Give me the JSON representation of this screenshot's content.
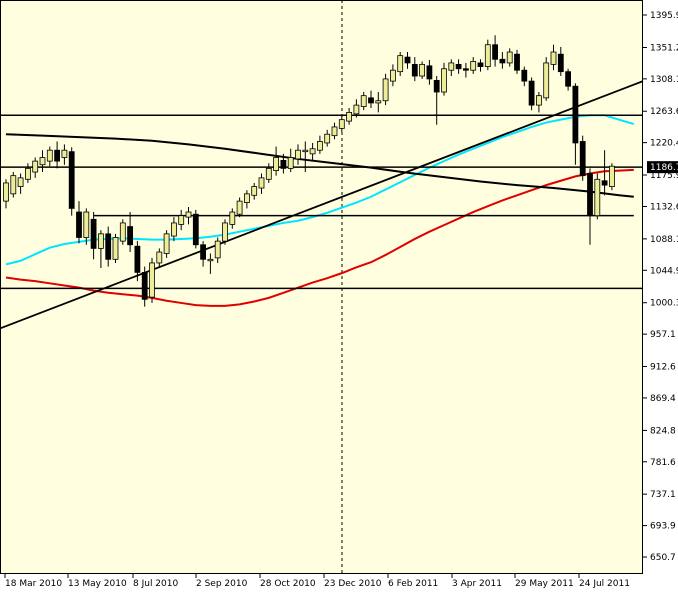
{
  "chart_data": {
    "type": "candlestick",
    "background": "#FFFFE0",
    "candle_up_fill": "#EEEE99",
    "candle_down_fill": "#000000",
    "ylim": [
      650.7,
      1395.9
    ],
    "y_ticks": [
      "1395.9",
      "1351.2",
      "1308.1",
      "1263.6",
      "1220.4",
      "1175.9",
      "1132.6",
      "1088.1",
      "1044.9",
      "1000.3",
      "957.1",
      "912.6",
      "869.4",
      "824.8",
      "781.6",
      "737.1",
      "693.9",
      "650.7"
    ],
    "x_labels": [
      "18 Mar 2010",
      "13 May 2010",
      "8 Jul 2010",
      "2 Sep 2010",
      "28 Oct 2010",
      "23 Dec 2010",
      "6 Feb 2011",
      "3 Apr 2011",
      "29 May 2011",
      "24 Jul 2011"
    ],
    "current_price_label": "1186.7",
    "current_price": 1186.7,
    "period_separator": "23 Dec 2010",
    "candles": [
      [
        1140,
        1165,
        1130,
        1170
      ],
      [
        1150,
        1175,
        1145,
        1180
      ],
      [
        1160,
        1172,
        1150,
        1178
      ],
      [
        1170,
        1185,
        1165,
        1192
      ],
      [
        1180,
        1195,
        1172,
        1200
      ],
      [
        1190,
        1200,
        1180,
        1210
      ],
      [
        1195,
        1210,
        1188,
        1215
      ],
      [
        1210,
        1195,
        1185,
        1222
      ],
      [
        1200,
        1210,
        1190,
        1218
      ],
      [
        1208,
        1130,
        1120,
        1214
      ],
      [
        1125,
        1090,
        1082,
        1140
      ],
      [
        1090,
        1125,
        1080,
        1130
      ],
      [
        1115,
        1075,
        1060,
        1125
      ],
      [
        1075,
        1095,
        1048,
        1100
      ],
      [
        1095,
        1060,
        1050,
        1105
      ],
      [
        1060,
        1090,
        1055,
        1095
      ],
      [
        1085,
        1110,
        1080,
        1115
      ],
      [
        1105,
        1080,
        1070,
        1125
      ],
      [
        1078,
        1042,
        1030,
        1085
      ],
      [
        1042,
        1005,
        995,
        1050
      ],
      [
        1008,
        1055,
        1000,
        1062
      ],
      [
        1055,
        1070,
        1048,
        1075
      ],
      [
        1068,
        1095,
        1062,
        1100
      ],
      [
        1092,
        1110,
        1085,
        1118
      ],
      [
        1108,
        1120,
        1100,
        1128
      ],
      [
        1118,
        1125,
        1108,
        1132
      ],
      [
        1122,
        1080,
        1075,
        1128
      ],
      [
        1080,
        1060,
        1050,
        1085
      ],
      [
        1058,
        1060,
        1040,
        1068
      ],
      [
        1062,
        1085,
        1055,
        1090
      ],
      [
        1085,
        1110,
        1080,
        1115
      ],
      [
        1108,
        1125,
        1102,
        1130
      ],
      [
        1122,
        1140,
        1118,
        1145
      ],
      [
        1138,
        1150,
        1130,
        1155
      ],
      [
        1148,
        1160,
        1142,
        1165
      ],
      [
        1158,
        1172,
        1150,
        1178
      ],
      [
        1170,
        1185,
        1165,
        1192
      ],
      [
        1182,
        1200,
        1175,
        1215
      ],
      [
        1196,
        1185,
        1178,
        1205
      ],
      [
        1185,
        1200,
        1180,
        1212
      ],
      [
        1198,
        1210,
        1190,
        1218
      ],
      [
        1208,
        1210,
        1180,
        1222
      ],
      [
        1205,
        1212,
        1195,
        1220
      ],
      [
        1210,
        1222,
        1205,
        1230
      ],
      [
        1220,
        1232,
        1215,
        1238
      ],
      [
        1230,
        1242,
        1225,
        1248
      ],
      [
        1240,
        1252,
        1235,
        1258
      ],
      [
        1250,
        1262,
        1245,
        1268
      ],
      [
        1260,
        1272,
        1255,
        1280
      ],
      [
        1270,
        1285,
        1265,
        1290
      ],
      [
        1282,
        1275,
        1268,
        1292
      ],
      [
        1275,
        1278,
        1262,
        1290
      ],
      [
        1278,
        1308,
        1272,
        1315
      ],
      [
        1305,
        1320,
        1298,
        1328
      ],
      [
        1318,
        1340,
        1312,
        1345
      ],
      [
        1338,
        1330,
        1322,
        1345
      ],
      [
        1328,
        1312,
        1305,
        1338
      ],
      [
        1312,
        1328,
        1308,
        1332
      ],
      [
        1326,
        1308,
        1300,
        1334
      ],
      [
        1306,
        1290,
        1245,
        1312
      ],
      [
        1290,
        1322,
        1285,
        1330
      ],
      [
        1320,
        1330,
        1312,
        1335
      ],
      [
        1328,
        1322,
        1315,
        1335
      ],
      [
        1322,
        1320,
        1310,
        1330
      ],
      [
        1320,
        1332,
        1315,
        1338
      ],
      [
        1330,
        1325,
        1318,
        1335
      ],
      [
        1325,
        1355,
        1320,
        1362
      ],
      [
        1355,
        1335,
        1325,
        1368
      ],
      [
        1335,
        1330,
        1322,
        1345
      ],
      [
        1330,
        1345,
        1325,
        1350
      ],
      [
        1342,
        1320,
        1315,
        1348
      ],
      [
        1320,
        1305,
        1298,
        1325
      ],
      [
        1305,
        1272,
        1265,
        1310
      ],
      [
        1272,
        1285,
        1262,
        1290
      ],
      [
        1282,
        1330,
        1278,
        1338
      ],
      [
        1328,
        1345,
        1320,
        1355
      ],
      [
        1342,
        1318,
        1312,
        1352
      ],
      [
        1318,
        1298,
        1292,
        1322
      ],
      [
        1298,
        1220,
        1190,
        1302
      ],
      [
        1222,
        1175,
        1168,
        1230
      ],
      [
        1178,
        1120,
        1080,
        1185
      ],
      [
        1120,
        1170,
        1115,
        1178
      ],
      [
        1168,
        1162,
        1148,
        1210
      ],
      [
        1160,
        1188,
        1155,
        1192
      ]
    ],
    "series": [
      {
        "color": "#00E5FF",
        "width": 2,
        "points": [
          [
            0,
            1053
          ],
          [
            2,
            1058
          ],
          [
            4,
            1067
          ],
          [
            6,
            1076
          ],
          [
            8,
            1081
          ],
          [
            10,
            1084
          ],
          [
            12,
            1087
          ],
          [
            14,
            1088
          ],
          [
            16,
            1089
          ],
          [
            18,
            1088
          ],
          [
            20,
            1087
          ],
          [
            22,
            1087
          ],
          [
            24,
            1088
          ],
          [
            26,
            1089
          ],
          [
            28,
            1091
          ],
          [
            30,
            1094
          ],
          [
            32,
            1098
          ],
          [
            34,
            1102
          ],
          [
            36,
            1106
          ],
          [
            38,
            1110
          ],
          [
            40,
            1113
          ],
          [
            42,
            1118
          ],
          [
            44,
            1124
          ],
          [
            46,
            1131
          ],
          [
            48,
            1138
          ],
          [
            50,
            1146
          ],
          [
            52,
            1156
          ],
          [
            54,
            1166
          ],
          [
            56,
            1176
          ],
          [
            58,
            1186
          ],
          [
            60,
            1195
          ],
          [
            62,
            1204
          ],
          [
            64,
            1212
          ],
          [
            66,
            1220
          ],
          [
            68,
            1228
          ],
          [
            70,
            1235
          ],
          [
            72,
            1242
          ],
          [
            74,
            1248
          ],
          [
            76,
            1252
          ],
          [
            78,
            1256
          ],
          [
            80,
            1258
          ],
          [
            82,
            1258
          ],
          [
            84,
            1252
          ],
          [
            86,
            1246
          ]
        ]
      },
      {
        "color": "#E00000",
        "width": 2,
        "points": [
          [
            0,
            1035
          ],
          [
            2,
            1032
          ],
          [
            4,
            1030
          ],
          [
            6,
            1027
          ],
          [
            8,
            1024
          ],
          [
            10,
            1021
          ],
          [
            12,
            1017
          ],
          [
            14,
            1014
          ],
          [
            16,
            1012
          ],
          [
            18,
            1010
          ],
          [
            20,
            1007
          ],
          [
            22,
            1003
          ],
          [
            24,
            1000
          ],
          [
            26,
            997
          ],
          [
            28,
            996
          ],
          [
            30,
            996
          ],
          [
            32,
            998
          ],
          [
            34,
            1002
          ],
          [
            36,
            1007
          ],
          [
            38,
            1014
          ],
          [
            40,
            1021
          ],
          [
            42,
            1028
          ],
          [
            44,
            1034
          ],
          [
            46,
            1041
          ],
          [
            48,
            1049
          ],
          [
            50,
            1056
          ],
          [
            52,
            1066
          ],
          [
            54,
            1077
          ],
          [
            56,
            1088
          ],
          [
            58,
            1098
          ],
          [
            60,
            1107
          ],
          [
            62,
            1116
          ],
          [
            64,
            1125
          ],
          [
            66,
            1133
          ],
          [
            68,
            1141
          ],
          [
            70,
            1148
          ],
          [
            72,
            1155
          ],
          [
            74,
            1162
          ],
          [
            76,
            1168
          ],
          [
            78,
            1174
          ],
          [
            80,
            1178
          ],
          [
            82,
            1181
          ],
          [
            84,
            1182
          ],
          [
            86,
            1183
          ]
        ]
      },
      {
        "color": "#000000",
        "width": 2,
        "points": [
          [
            0,
            1232
          ],
          [
            5,
            1230
          ],
          [
            10,
            1228
          ],
          [
            15,
            1226
          ],
          [
            20,
            1223
          ],
          [
            25,
            1218
          ],
          [
            30,
            1212
          ],
          [
            35,
            1205
          ],
          [
            40,
            1198
          ],
          [
            45,
            1192
          ],
          [
            50,
            1186
          ],
          [
            55,
            1179
          ],
          [
            60,
            1173
          ],
          [
            65,
            1167
          ],
          [
            70,
            1162
          ],
          [
            75,
            1158
          ],
          [
            80,
            1153
          ],
          [
            84,
            1148
          ],
          [
            86,
            1146
          ]
        ]
      }
    ],
    "horizontal_lines": [
      1186.7,
      1120,
      1020,
      1258
    ],
    "support_segments": [
      [
        12,
        1120,
        86,
        1120
      ]
    ],
    "trendline": [
      [
        -1,
        965
      ],
      [
        86,
        1305
      ]
    ]
  }
}
